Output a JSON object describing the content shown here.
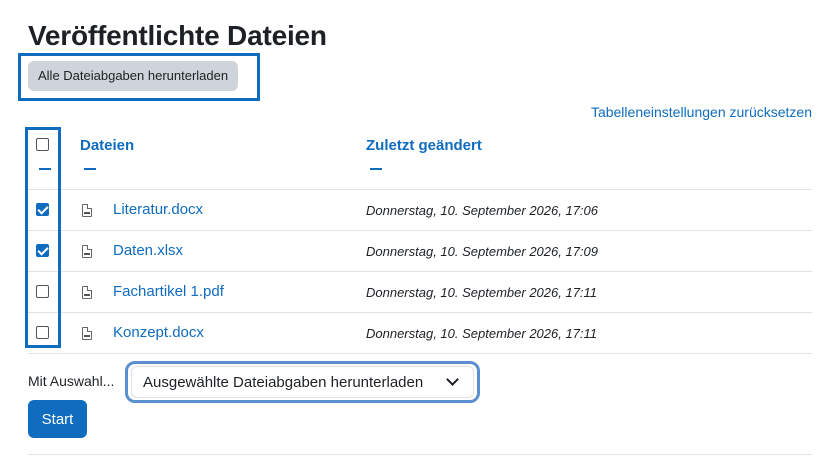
{
  "page": {
    "title": "Veröffentlichte Dateien"
  },
  "toolbar": {
    "download_all_label": "Alle Dateiabgaben herunterladen",
    "reset_table_label": "Tabelleneinstellungen zurücksetzen"
  },
  "table": {
    "columns": {
      "files": "Dateien",
      "modified": "Zuletzt geändert"
    },
    "select_all_checked": false,
    "rows": [
      {
        "name": "Literatur.docx",
        "modified": "Donnerstag, 10. September 2026, 17:06",
        "checked": true,
        "icon": "document-icon"
      },
      {
        "name": "Daten.xlsx",
        "modified": "Donnerstag, 10. September 2026, 17:09",
        "checked": true,
        "icon": "spreadsheet-icon"
      },
      {
        "name": "Fachartikel 1.pdf",
        "modified": "Donnerstag, 10. September 2026, 17:11",
        "checked": false,
        "icon": "pdf-icon"
      },
      {
        "name": "Konzept.docx",
        "modified": "Donnerstag, 10. September 2026, 17:11",
        "checked": false,
        "icon": "document-icon"
      }
    ]
  },
  "bulk": {
    "label": "Mit Auswahl...",
    "selected_option": "Ausgewählte Dateiabgaben herunterladen",
    "start_label": "Start"
  },
  "colors": {
    "accent": "#0f6cbf",
    "highlight_border": "#0f6cbf",
    "button_gray": "#ced4da"
  }
}
